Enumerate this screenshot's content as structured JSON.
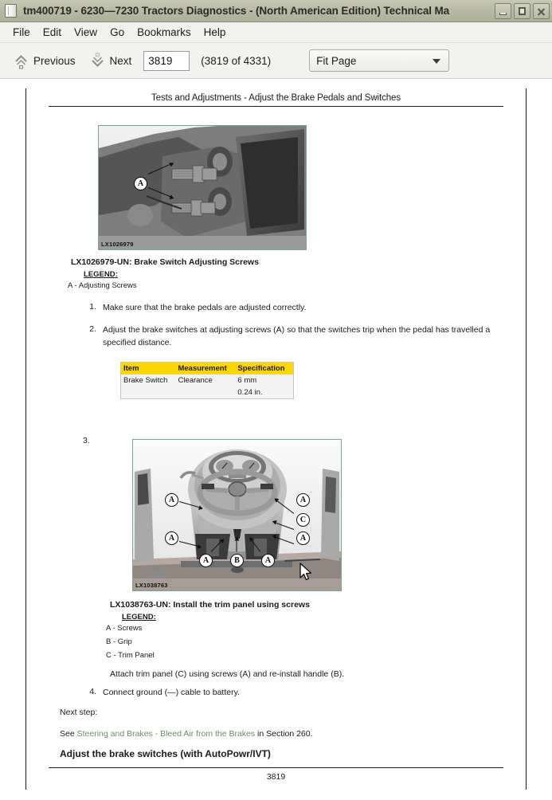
{
  "window": {
    "title": "tm400719 - 6230—7230 Tractors Diagnostics - (North American Edition) Technical Ma",
    "icon": "document-icon",
    "minimize_label": "Minimize",
    "maximize_label": "Maximize",
    "close_label": "Close"
  },
  "menubar": {
    "items": [
      {
        "label": "File"
      },
      {
        "label": "Edit"
      },
      {
        "label": "View"
      },
      {
        "label": "Go"
      },
      {
        "label": "Bookmarks"
      },
      {
        "label": "Help"
      }
    ]
  },
  "toolbar": {
    "previous_label": "Previous",
    "next_label": "Next",
    "page_value": "3819",
    "page_placeholder": "",
    "page_count_text": "(3819 of 4331)",
    "zoom_value": "Fit Page"
  },
  "document": {
    "header": "Tests and Adjustments - Adjust the Brake Pedals and Switches",
    "footer_page": "3819",
    "link_color": "#6a8f6a",
    "figure_border_color": "#7da583",
    "table_header_color": "#ffd700",
    "figure1": {
      "code": "LX1026979",
      "caption": "LX1026979-UN: Brake Switch Adjusting Screws",
      "legend_title": "LEGEND:",
      "legend": [
        "A - Adjusting Screws"
      ],
      "callouts": [
        "A"
      ]
    },
    "figure2": {
      "code": "LX1038763",
      "caption": "LX1038763-UN: Install the trim panel using screws",
      "legend_title": "LEGEND:",
      "legend": [
        "A - Screws",
        "B - Grip",
        "C - Trim Panel"
      ],
      "callouts": [
        "A",
        "A",
        "C",
        "A",
        "A",
        "A",
        "B",
        "A"
      ]
    },
    "steps": [
      {
        "num": "1.",
        "text": "Make sure that the brake pedals are adjusted correctly."
      },
      {
        "num": "2.",
        "text": "Adjust the brake switches at adjusting screws (A) so that the switches trip when the pedal has travelled a specified distance."
      },
      {
        "num": "3.",
        "text": ""
      },
      {
        "num": "4.",
        "text": "Connect ground (—) cable to battery."
      }
    ],
    "step3_text": "Attach trim panel (C) using screws (A) and re-install handle (B).",
    "spec_table": {
      "headers": [
        "Item",
        "Measurement",
        "Specification"
      ],
      "rows": [
        [
          "Brake Switch",
          "Clearance",
          "6 mm"
        ],
        [
          "",
          "",
          "0.24 in."
        ]
      ]
    },
    "next_step_label": "Next step:",
    "see_prefix": "See ",
    "see_link": "Steering and Brakes - Bleed Air from the Brakes",
    "see_suffix": " in Section 260.",
    "section_heading": "Adjust the brake switches (with AutoPowr/IVT)"
  }
}
